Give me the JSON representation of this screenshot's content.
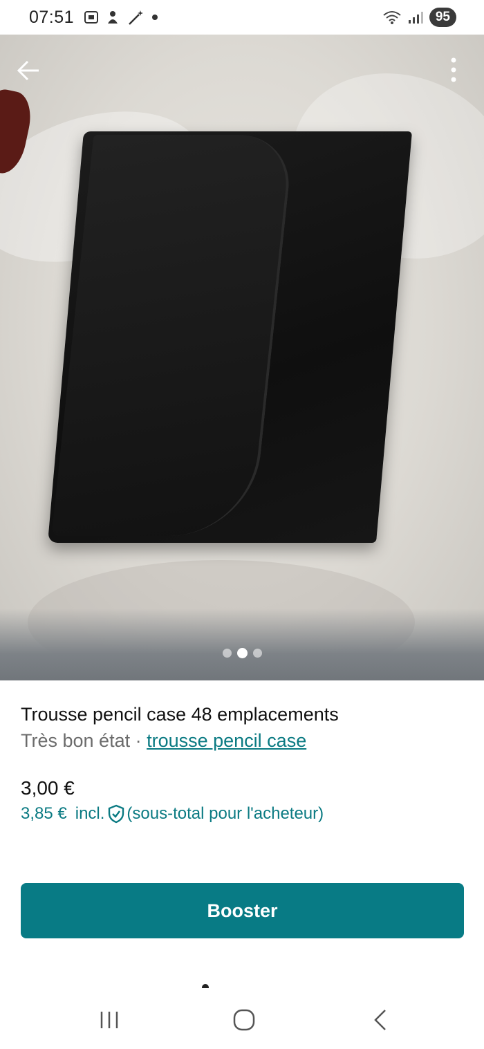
{
  "status_bar": {
    "time": "07:51",
    "battery": "95",
    "icons": [
      "screenshot-icon",
      "notification-icon",
      "magic-wand-icon",
      "dot-icon",
      "wifi-icon",
      "signal-icon"
    ]
  },
  "listing": {
    "title": "Trousse pencil case 48 emplacements",
    "condition": "Très bon état",
    "separator": " · ",
    "category": "trousse pencil case",
    "price": "3,00 €",
    "buyer_price": "3,85 €",
    "buyer_price_incl": "incl.",
    "buyer_price_note": "(sous-total pour l'acheteur)"
  },
  "gallery": {
    "image_count": 3,
    "active_index": 1
  },
  "actions": {
    "booster_label": "Booster"
  },
  "colors": {
    "accent": "#087b85",
    "link": "#0a7a82"
  }
}
